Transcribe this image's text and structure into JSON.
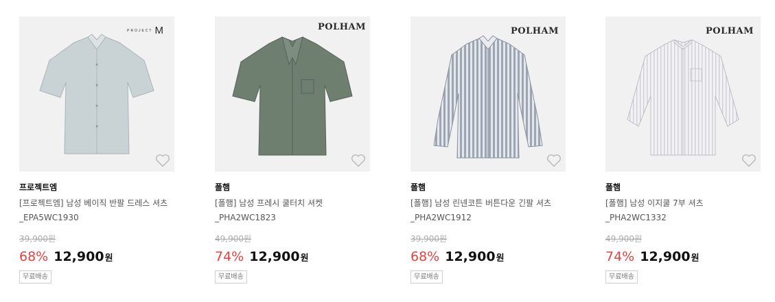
{
  "products": [
    {
      "brand": "프로젝트엠",
      "logo": "PROJECT M",
      "title": "[프로젝트엠] 남성 베이직 반팔 드레스 셔츠_EPA5WC1930",
      "original_price": "39,900원",
      "discount": "68%",
      "price": "12,900",
      "currency": "원",
      "shipping_badge": "무료배송",
      "shirt_color": "#c9d3d6"
    },
    {
      "brand": "폴햄",
      "logo": "POLHAM",
      "title": "[폴햄] 남성 프레시 쿨터치 셔켓_PHA2WC1823",
      "original_price": "49,900원",
      "discount": "74%",
      "price": "12,900",
      "currency": "원",
      "shipping_badge": "무료배송",
      "shirt_color": "#6e7e6f"
    },
    {
      "brand": "폴햄",
      "logo": "POLHAM",
      "title": "[폴햄] 남성 린넨코튼 버튼다운 긴팔 셔츠_PHA2WC1912",
      "original_price": "39,900원",
      "discount": "68%",
      "price": "12,900",
      "currency": "원",
      "shipping_badge": "무료배송",
      "shirt_color": "#b8bfc9"
    },
    {
      "brand": "폴햄",
      "logo": "POLHAM",
      "title": "[폴햄] 남성 이지쿨 7부 셔츠_PHA2WC1332",
      "original_price": "49,900원",
      "discount": "74%",
      "price": "12,900",
      "currency": "원",
      "shipping_badge": "무료배송",
      "shirt_color": "#e6e6ea"
    }
  ]
}
